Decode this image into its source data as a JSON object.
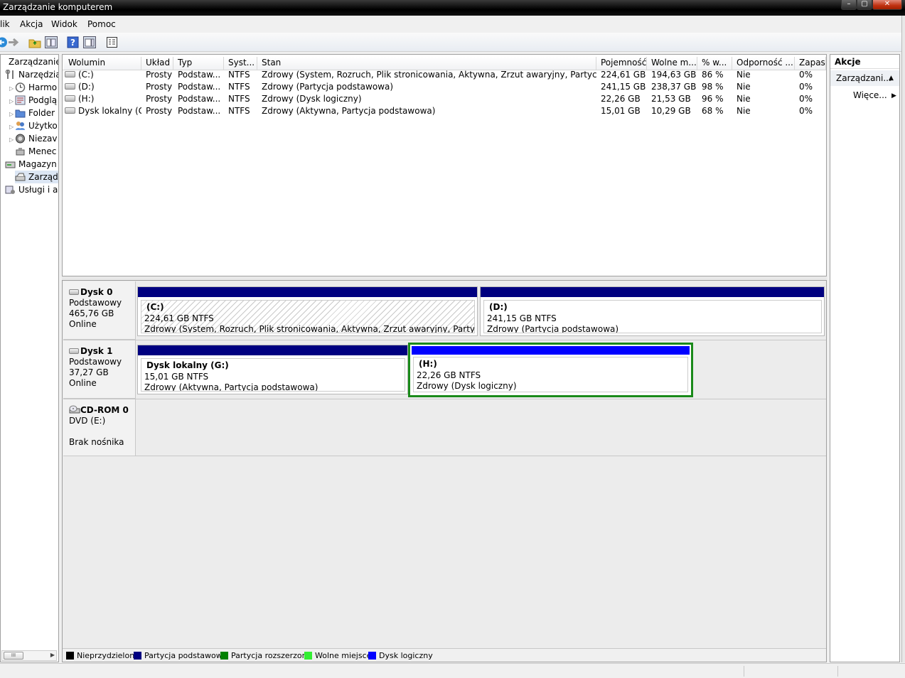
{
  "window": {
    "title": "Zarządzanie komputerem"
  },
  "menu": [
    "lik",
    "Akcja",
    "Widok",
    "Pomoc"
  ],
  "tree": {
    "items": [
      {
        "label": "Zarządzanie k",
        "icon": "computer-management-icon",
        "level": 0
      },
      {
        "label": "Narzędzia",
        "icon": "tools-icon",
        "level": 1
      },
      {
        "label": "Harmo",
        "icon": "clock-icon",
        "level": 2
      },
      {
        "label": "Podglą",
        "icon": "event-viewer-icon",
        "level": 2
      },
      {
        "label": "Folder",
        "icon": "folder-icon",
        "level": 2
      },
      {
        "label": "Użytko",
        "icon": "users-icon",
        "level": 2
      },
      {
        "label": "Niezav",
        "icon": "performance-icon",
        "level": 2
      },
      {
        "label": "Menec",
        "icon": "device-manager-icon",
        "level": 2
      },
      {
        "label": "Magazyn",
        "icon": "storage-icon",
        "level": 1
      },
      {
        "label": "Zarząd",
        "icon": "disk-management-icon",
        "level": 2
      },
      {
        "label": "Usługi i ap",
        "icon": "services-icon",
        "level": 1
      }
    ],
    "scroll_thumb": "III"
  },
  "volumes": {
    "headers": [
      "Wolumin",
      "Układ",
      "Typ",
      "Syst...",
      "Stan",
      "Pojemność",
      "Wolne m...",
      "% w...",
      "Odporność ...",
      "Zapas"
    ],
    "rows": [
      [
        "(C:)",
        "Prosty",
        "Podstaw...",
        "NTFS",
        "Zdrowy (System, Rozruch, Plik stronicowania, Aktywna, Zrzut awaryjny, Partycja podst...",
        "224,61 GB",
        "194,63 GB",
        "86 %",
        "Nie",
        "0%"
      ],
      [
        "(D:)",
        "Prosty",
        "Podstaw...",
        "NTFS",
        "Zdrowy (Partycja podstawowa)",
        "241,15 GB",
        "238,37 GB",
        "98 %",
        "Nie",
        "0%"
      ],
      [
        "(H:)",
        "Prosty",
        "Podstaw...",
        "NTFS",
        "Zdrowy (Dysk logiczny)",
        "22,26 GB",
        "21,53 GB",
        "96 %",
        "Nie",
        "0%"
      ],
      [
        "Dysk lokalny (G:)",
        "Prosty",
        "Podstaw...",
        "NTFS",
        "Zdrowy (Aktywna, Partycja podstawowa)",
        "15,01 GB",
        "10,29 GB",
        "68 %",
        "Nie",
        "0%"
      ]
    ]
  },
  "disks": [
    {
      "name": "Dysk 0",
      "type": "Podstawowy",
      "size": "465,76 GB",
      "status": "Online",
      "partitions": [
        {
          "title": "(C:)",
          "size": "224,61 GB NTFS",
          "status": "Zdrowy (System, Rozruch, Plik stronicowania, Aktywna, Zrzut awaryjny, Partycja podstawowa)"
        },
        {
          "title": "(D:)",
          "size": "241,15 GB NTFS",
          "status": "Zdrowy (Partycja podstawowa)"
        }
      ]
    },
    {
      "name": "Dysk 1",
      "type": "Podstawowy",
      "size": "37,27 GB",
      "status": "Online",
      "partitions": [
        {
          "title": "Dysk lokalny  (G:)",
          "size": "15,01 GB NTFS",
          "status": "Zdrowy (Aktywna, Partycja podstawowa)"
        },
        {
          "title": "(H:)",
          "size": "22,26 GB NTFS",
          "status": "Zdrowy (Dysk logiczny)"
        }
      ]
    },
    {
      "name": "CD-ROM 0",
      "type": "DVD (E:)",
      "size": "",
      "status": "Brak nośnika",
      "partitions": []
    }
  ],
  "legend": [
    {
      "label": "Nieprzydzielone",
      "color": "#000000"
    },
    {
      "label": "Partycja podstawowa",
      "color": "#000080"
    },
    {
      "label": "Partycja rozszerzona",
      "color": "#008000"
    },
    {
      "label": "Wolne miejsce",
      "color": "#33ee33"
    },
    {
      "label": "Dysk logiczny",
      "color": "#0000ff"
    }
  ],
  "actions": {
    "header": "Akcje",
    "section": "Zarządzani...",
    "more": "Więce..."
  },
  "colors": {
    "primary_partition": "#000080",
    "logical_drive": "#0000ff",
    "extended_partition": "#008000"
  }
}
